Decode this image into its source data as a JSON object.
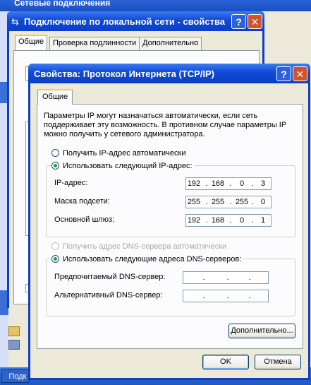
{
  "background_window": {
    "title": "Сетевые подключения",
    "bottom_button": "Подк"
  },
  "connection_dialog": {
    "title": "Подключение по локальной сети - свойства",
    "tabs": [
      "Общие",
      "Проверка подлинности",
      "Дополнительно"
    ],
    "help_label": "?",
    "close_label": "✕"
  },
  "tcpip_dialog": {
    "title": "Свойства: Протокол Интернета (TCP/IP)",
    "help_label": "?",
    "close_label": "✕",
    "tab": "Общие",
    "description": "Параметры IP могут назначаться автоматически, если сеть поддерживает эту возможность. В противном случае параметры IP можно получить у сетевого администратора.",
    "ip_auto_label": "Получить IP-адрес автоматически",
    "ip_manual_label": "Использовать следующий IP-адрес:",
    "ip_mode": "manual",
    "ip_address_label": "IP-адрес:",
    "ip_address": [
      "192",
      "168",
      "0",
      "3"
    ],
    "subnet_label": "Маска подсети:",
    "subnet": [
      "255",
      "255",
      "255",
      "0"
    ],
    "gateway_label": "Основной шлюз:",
    "gateway": [
      "192",
      "168",
      "0",
      "1"
    ],
    "dns_auto_label": "Получить адрес DNS-сервера автоматически",
    "dns_manual_label": "Использовать следующие адреса DNS-серверов:",
    "dns_mode": "manual",
    "preferred_dns_label": "Предпочитаемый DNS-сервер:",
    "preferred_dns": [
      "",
      "",
      "",
      ""
    ],
    "alternate_dns_label": "Альтернативный DNS-сервер:",
    "alternate_dns": [
      "",
      "",
      "",
      ""
    ],
    "advanced_button": "Дополнительно...",
    "ok_button": "OK",
    "cancel_button": "Отмена",
    "octet_separator": "."
  }
}
